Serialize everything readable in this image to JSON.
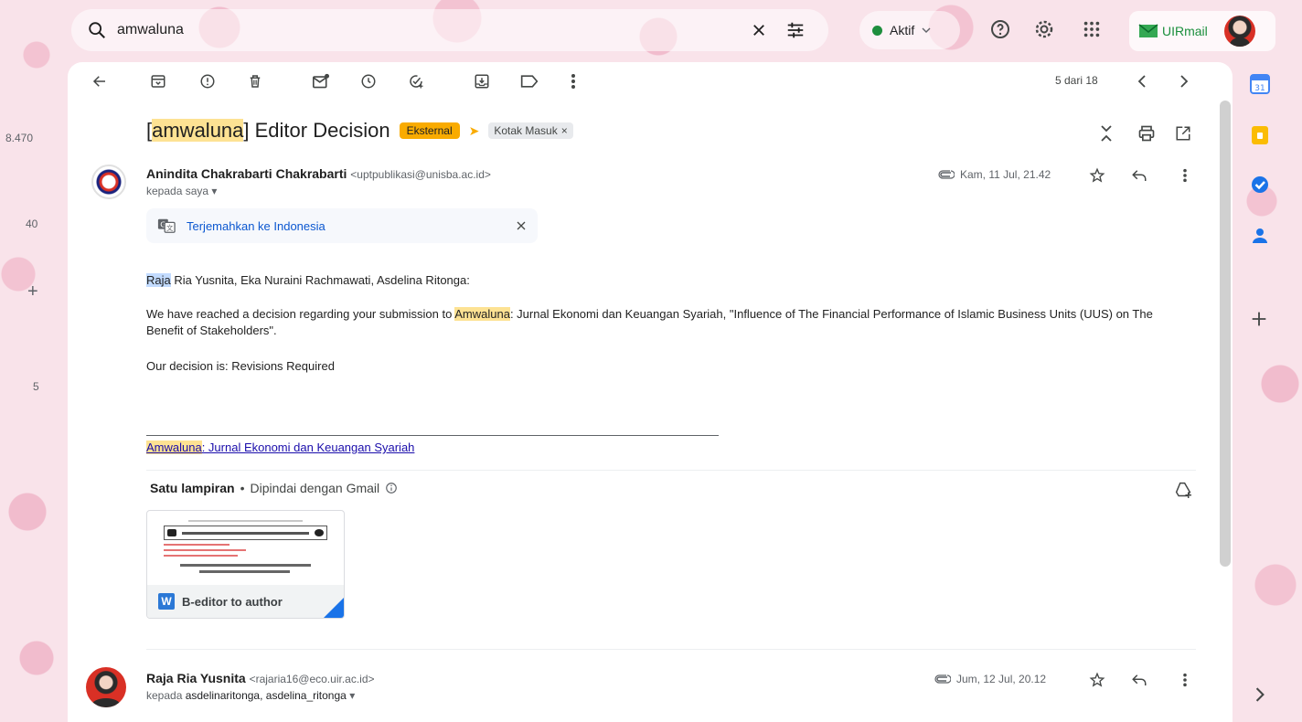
{
  "search": {
    "query": "amwaluna"
  },
  "status": {
    "label": "Aktif"
  },
  "brand": {
    "name": "UIRmail"
  },
  "ruler": {
    "numbers": [
      "8.470",
      "40",
      "+",
      "5"
    ]
  },
  "pager": {
    "text": "5 dari 18"
  },
  "message": {
    "subject_prefix": "[",
    "subject_highlight": "amwaluna",
    "subject_rest": "] Editor Decision",
    "label_external": "Eksternal",
    "label_inbox": "Kotak Masuk",
    "label_inbox_close": "×",
    "sender_name": "Anindita Chakrabarti Chakrabarti",
    "sender_email": "<uptpublikasi@unisba.ac.id>",
    "to_line": "kepada saya",
    "date": "Kam, 11 Jul, 21.42",
    "translate_label": "Terjemahkan ke Indonesia",
    "greeting_highlight": "Raja",
    "greeting_rest": " Ria Yusnita, Eka Nuraini Rachmawati, Asdelina Ritonga:",
    "para1_start": "We have reached a decision regarding your submission to ",
    "para1_highlight": "Amwaluna",
    "para1_rest": ": Jurnal Ekonomi dan Keuangan Syariah, \"Influence of The Financial Performance of Islamic Business Units (UUS) on The Benefit of Stakeholders\".",
    "decision": "Our decision is: Revisions Required",
    "sig_highlight": "Amwaluna",
    "sig_rest": ": Jurnal Ekonomi dan Keuangan Syariah"
  },
  "attachments": {
    "heading_bold": "Satu lampiran",
    "heading_sep": " • ",
    "heading_rest": "Dipindai dengan Gmail",
    "file_type": "W",
    "file_name": "B-editor to author"
  },
  "reply": {
    "sender_name": "Raja Ria Yusnita",
    "sender_email": "<rajaria16@eco.uir.ac.id>",
    "to_prefix": "kepada ",
    "to_recipients": "asdelinaritonga, asdelina_ritonga",
    "date": "Jum, 12 Jul, 20.12"
  },
  "colors": {
    "external_chip": "#f9ab00",
    "highlight": "#fde293",
    "link": "#0b57d0",
    "brand_green": "#1a8f3c",
    "status_green": "#1e8e3e"
  }
}
